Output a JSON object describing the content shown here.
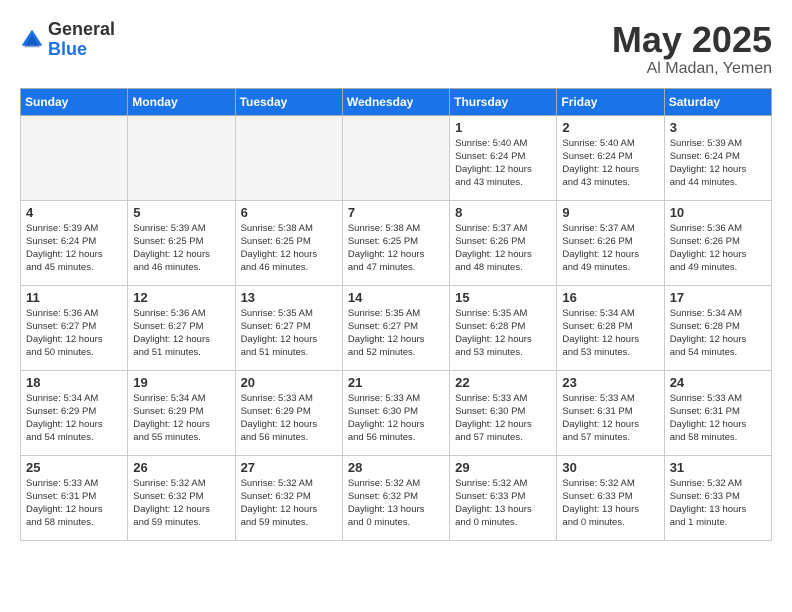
{
  "header": {
    "logo_general": "General",
    "logo_blue": "Blue",
    "month": "May 2025",
    "location": "Al Madan, Yemen"
  },
  "days_of_week": [
    "Sunday",
    "Monday",
    "Tuesday",
    "Wednesday",
    "Thursday",
    "Friday",
    "Saturday"
  ],
  "weeks": [
    [
      {
        "day": "",
        "info": ""
      },
      {
        "day": "",
        "info": ""
      },
      {
        "day": "",
        "info": ""
      },
      {
        "day": "",
        "info": ""
      },
      {
        "day": "1",
        "info": "Sunrise: 5:40 AM\nSunset: 6:24 PM\nDaylight: 12 hours\nand 43 minutes."
      },
      {
        "day": "2",
        "info": "Sunrise: 5:40 AM\nSunset: 6:24 PM\nDaylight: 12 hours\nand 43 minutes."
      },
      {
        "day": "3",
        "info": "Sunrise: 5:39 AM\nSunset: 6:24 PM\nDaylight: 12 hours\nand 44 minutes."
      }
    ],
    [
      {
        "day": "4",
        "info": "Sunrise: 5:39 AM\nSunset: 6:24 PM\nDaylight: 12 hours\nand 45 minutes."
      },
      {
        "day": "5",
        "info": "Sunrise: 5:39 AM\nSunset: 6:25 PM\nDaylight: 12 hours\nand 46 minutes."
      },
      {
        "day": "6",
        "info": "Sunrise: 5:38 AM\nSunset: 6:25 PM\nDaylight: 12 hours\nand 46 minutes."
      },
      {
        "day": "7",
        "info": "Sunrise: 5:38 AM\nSunset: 6:25 PM\nDaylight: 12 hours\nand 47 minutes."
      },
      {
        "day": "8",
        "info": "Sunrise: 5:37 AM\nSunset: 6:26 PM\nDaylight: 12 hours\nand 48 minutes."
      },
      {
        "day": "9",
        "info": "Sunrise: 5:37 AM\nSunset: 6:26 PM\nDaylight: 12 hours\nand 49 minutes."
      },
      {
        "day": "10",
        "info": "Sunrise: 5:36 AM\nSunset: 6:26 PM\nDaylight: 12 hours\nand 49 minutes."
      }
    ],
    [
      {
        "day": "11",
        "info": "Sunrise: 5:36 AM\nSunset: 6:27 PM\nDaylight: 12 hours\nand 50 minutes."
      },
      {
        "day": "12",
        "info": "Sunrise: 5:36 AM\nSunset: 6:27 PM\nDaylight: 12 hours\nand 51 minutes."
      },
      {
        "day": "13",
        "info": "Sunrise: 5:35 AM\nSunset: 6:27 PM\nDaylight: 12 hours\nand 51 minutes."
      },
      {
        "day": "14",
        "info": "Sunrise: 5:35 AM\nSunset: 6:27 PM\nDaylight: 12 hours\nand 52 minutes."
      },
      {
        "day": "15",
        "info": "Sunrise: 5:35 AM\nSunset: 6:28 PM\nDaylight: 12 hours\nand 53 minutes."
      },
      {
        "day": "16",
        "info": "Sunrise: 5:34 AM\nSunset: 6:28 PM\nDaylight: 12 hours\nand 53 minutes."
      },
      {
        "day": "17",
        "info": "Sunrise: 5:34 AM\nSunset: 6:28 PM\nDaylight: 12 hours\nand 54 minutes."
      }
    ],
    [
      {
        "day": "18",
        "info": "Sunrise: 5:34 AM\nSunset: 6:29 PM\nDaylight: 12 hours\nand 54 minutes."
      },
      {
        "day": "19",
        "info": "Sunrise: 5:34 AM\nSunset: 6:29 PM\nDaylight: 12 hours\nand 55 minutes."
      },
      {
        "day": "20",
        "info": "Sunrise: 5:33 AM\nSunset: 6:29 PM\nDaylight: 12 hours\nand 56 minutes."
      },
      {
        "day": "21",
        "info": "Sunrise: 5:33 AM\nSunset: 6:30 PM\nDaylight: 12 hours\nand 56 minutes."
      },
      {
        "day": "22",
        "info": "Sunrise: 5:33 AM\nSunset: 6:30 PM\nDaylight: 12 hours\nand 57 minutes."
      },
      {
        "day": "23",
        "info": "Sunrise: 5:33 AM\nSunset: 6:31 PM\nDaylight: 12 hours\nand 57 minutes."
      },
      {
        "day": "24",
        "info": "Sunrise: 5:33 AM\nSunset: 6:31 PM\nDaylight: 12 hours\nand 58 minutes."
      }
    ],
    [
      {
        "day": "25",
        "info": "Sunrise: 5:33 AM\nSunset: 6:31 PM\nDaylight: 12 hours\nand 58 minutes."
      },
      {
        "day": "26",
        "info": "Sunrise: 5:32 AM\nSunset: 6:32 PM\nDaylight: 12 hours\nand 59 minutes."
      },
      {
        "day": "27",
        "info": "Sunrise: 5:32 AM\nSunset: 6:32 PM\nDaylight: 12 hours\nand 59 minutes."
      },
      {
        "day": "28",
        "info": "Sunrise: 5:32 AM\nSunset: 6:32 PM\nDaylight: 13 hours\nand 0 minutes."
      },
      {
        "day": "29",
        "info": "Sunrise: 5:32 AM\nSunset: 6:33 PM\nDaylight: 13 hours\nand 0 minutes."
      },
      {
        "day": "30",
        "info": "Sunrise: 5:32 AM\nSunset: 6:33 PM\nDaylight: 13 hours\nand 0 minutes."
      },
      {
        "day": "31",
        "info": "Sunrise: 5:32 AM\nSunset: 6:33 PM\nDaylight: 13 hours\nand 1 minute."
      }
    ]
  ]
}
